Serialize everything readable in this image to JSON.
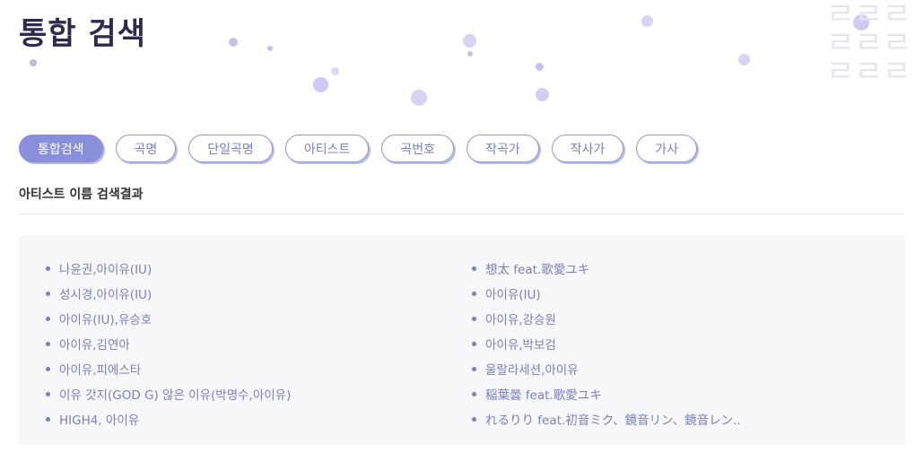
{
  "header": {
    "title": "통합 검색"
  },
  "tabs": [
    {
      "label": "통합검색",
      "active": true
    },
    {
      "label": "곡명",
      "active": false
    },
    {
      "label": "단일곡명",
      "active": false
    },
    {
      "label": "아티스트",
      "active": false
    },
    {
      "label": "곡번호",
      "active": false
    },
    {
      "label": "작곡가",
      "active": false
    },
    {
      "label": "작사가",
      "active": false
    },
    {
      "label": "가사",
      "active": false
    }
  ],
  "section": {
    "subtitle": "아티스트 이름 검색결과"
  },
  "results": {
    "left": [
      "나윤권,아이유(IU)",
      "성시경,아이유(IU)",
      "아이유(IU),유승호",
      "아이유,김연아",
      "아이유,피에스타",
      "이유 갓지(GOD G) 않은 이유(박명수,아이유)",
      "HIGH4, 아이유"
    ],
    "right": [
      "想太 feat.歌愛ユキ",
      "아이유(IU)",
      "아이유,강승원",
      "아이유,박보검",
      "울랄라세션,아이유",
      "稲葉曇 feat.歌愛ユキ",
      "れるりり feat.初音ミク、鏡音リン、鏡音レン.."
    ]
  },
  "colors": {
    "accent": "#8a8fdc",
    "link": "#7a7fbf",
    "title": "#2e2a4f",
    "panel": "#f7f7fa"
  }
}
